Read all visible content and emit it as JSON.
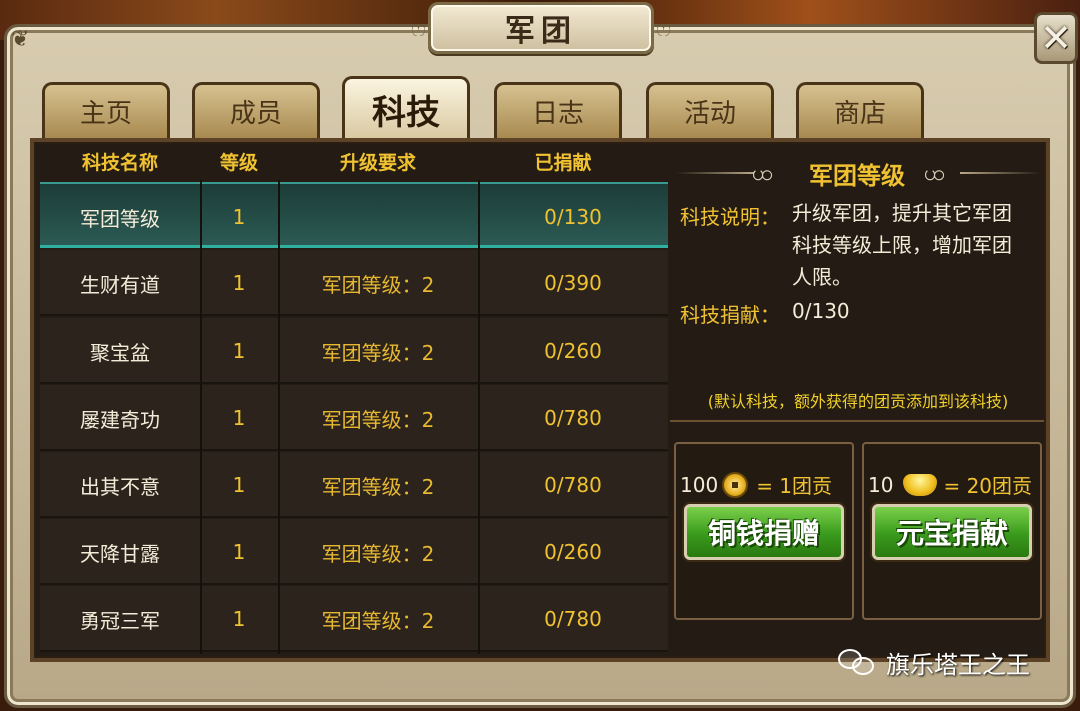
{
  "window": {
    "title": "军团",
    "close_symbol": "✕"
  },
  "tabs": [
    {
      "label": "主页",
      "active": false
    },
    {
      "label": "成员",
      "active": false
    },
    {
      "label": "科技",
      "active": true
    },
    {
      "label": "日志",
      "active": false
    },
    {
      "label": "活动",
      "active": false
    },
    {
      "label": "商店",
      "active": false
    }
  ],
  "table": {
    "headers": [
      "科技名称",
      "等级",
      "升级要求",
      "已捐献"
    ],
    "rows": [
      {
        "name": "军团等级",
        "level": "1",
        "requirement": "",
        "donated": "0/130",
        "selected": true
      },
      {
        "name": "生财有道",
        "level": "1",
        "requirement": "军团等级：2",
        "donated": "0/390"
      },
      {
        "name": "聚宝盆",
        "level": "1",
        "requirement": "军团等级：2",
        "donated": "0/260"
      },
      {
        "name": "屡建奇功",
        "level": "1",
        "requirement": "军团等级：2",
        "donated": "0/780"
      },
      {
        "name": "出其不意",
        "level": "1",
        "requirement": "军团等级：2",
        "donated": "0/780"
      },
      {
        "name": "天降甘露",
        "level": "1",
        "requirement": "军团等级：2",
        "donated": "0/260"
      },
      {
        "name": "勇冠三军",
        "level": "1",
        "requirement": "军团等级：2",
        "donated": "0/780"
      }
    ]
  },
  "detail": {
    "title": "军团等级",
    "desc_label": "科技说明：",
    "desc_lines": [
      "升级军团，提升其它军团",
      "科技等级上限，增加军团",
      "人限。"
    ],
    "donation_label": "科技捐献：",
    "donation_value": "0/130",
    "note": "(默认科技，额外获得的团贡添加到该科技)"
  },
  "donate": {
    "copper": {
      "amount": "100",
      "icon": "copper-coin-icon",
      "rate": "= 1团贡",
      "button": "铜钱捐赠"
    },
    "ingot": {
      "amount": "10",
      "icon": "gold-ingot-icon",
      "rate": "= 20团贡",
      "button": "元宝捐献"
    }
  },
  "watermark": {
    "text": "旗乐塔王之王",
    "icon": "wechat-icon"
  },
  "colors": {
    "header_gold": "#f0c232",
    "panel_bg": "#241c14",
    "selected_row": "#2c5a54",
    "button_green": "#3a9a1c"
  }
}
